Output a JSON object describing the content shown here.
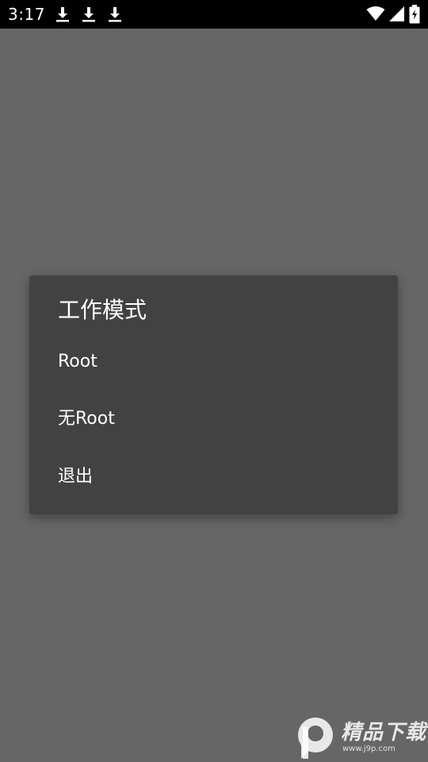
{
  "status_bar": {
    "time": "3:17",
    "notification_icons": [
      "download-icon",
      "download-icon",
      "download-icon"
    ],
    "system_icons": [
      "wifi-icon",
      "signal-icon",
      "battery-icon"
    ]
  },
  "dialog": {
    "title": "工作模式",
    "items": [
      {
        "label": "Root"
      },
      {
        "label": "无Root"
      },
      {
        "label": "退出"
      }
    ]
  },
  "watermark": {
    "brand": "精品下载",
    "url": "www.j9p.com"
  },
  "colors": {
    "background": "#666666",
    "status_bar": "#000000",
    "dialog": "#424242",
    "text": "#ffffff"
  }
}
